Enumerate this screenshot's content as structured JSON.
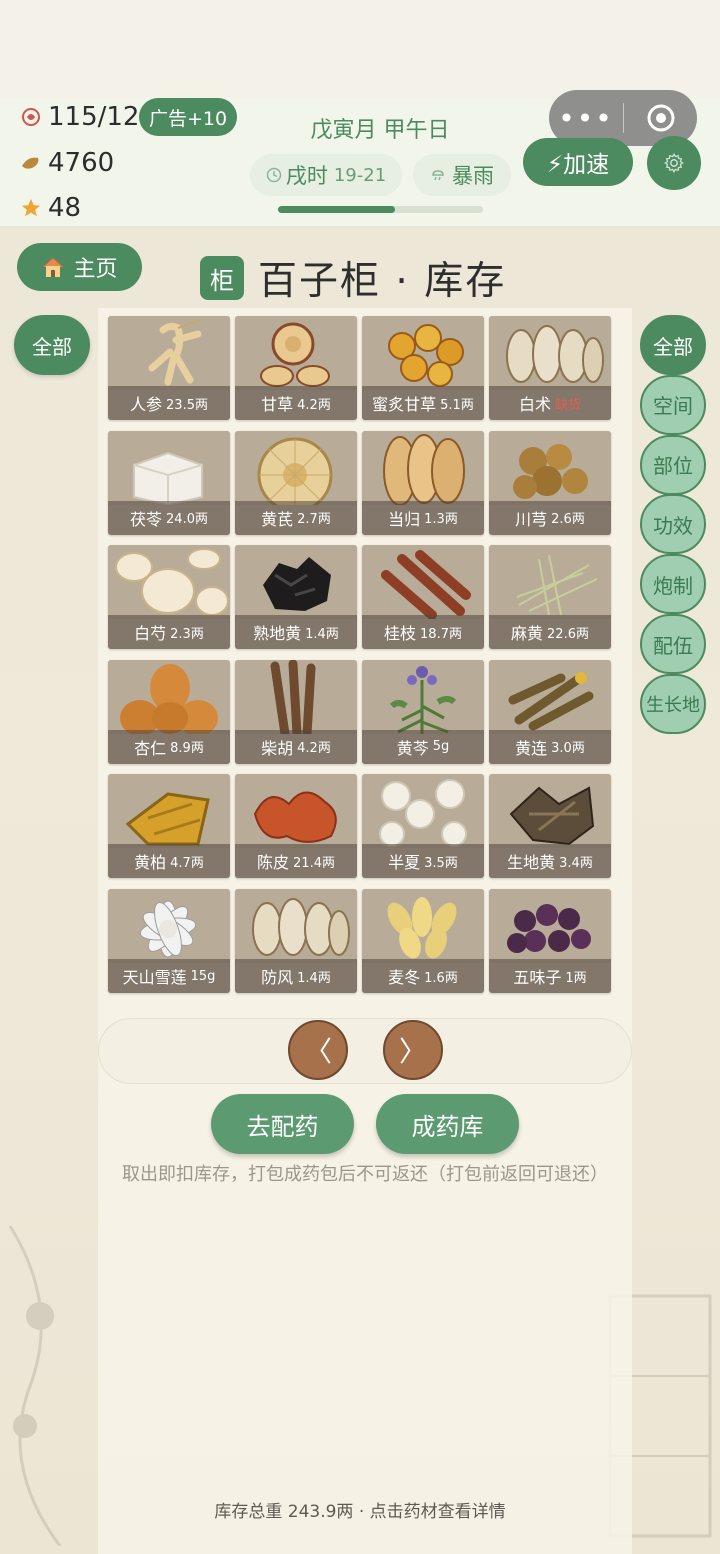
{
  "status": {
    "energy": "115/120",
    "ad_label": "广告+10",
    "coins": "4760",
    "stars": "48",
    "date": "戊寅月 甲午日",
    "time_label": "戌时",
    "time_range": "19-21",
    "weather": "暴雨",
    "day_progress": 0.57,
    "speed_label": "⚡加速"
  },
  "capsule": {
    "more": "•••"
  },
  "nav": {
    "home_label": "主页"
  },
  "title": {
    "badge": "柜",
    "text": "百子柜 · 库存"
  },
  "left_filter": {
    "label": "全部"
  },
  "right_tabs": [
    "全部",
    "空间",
    "部位",
    "功效",
    "炮制",
    "配伍",
    "生长地"
  ],
  "herbs": [
    {
      "name": "人参",
      "qty": "23.5两",
      "art": "ginseng"
    },
    {
      "name": "甘草",
      "qty": "4.2两",
      "art": "slices"
    },
    {
      "name": "蜜炙甘草",
      "qty": "5.1两",
      "art": "honeyslices"
    },
    {
      "name": "白术",
      "qty": "",
      "lack": "缺货",
      "art": "baizhu"
    },
    {
      "name": "茯苓",
      "qty": "24.0两",
      "art": "cube"
    },
    {
      "name": "黄芪",
      "qty": "2.7两",
      "art": "bigslice"
    },
    {
      "name": "当归",
      "qty": "1.3两",
      "art": "danggui"
    },
    {
      "name": "川芎",
      "qty": "2.6两",
      "art": "chuanxiong"
    },
    {
      "name": "白芍",
      "qty": "2.3两",
      "art": "whiteslices"
    },
    {
      "name": "熟地黄",
      "qty": "1.4两",
      "art": "black"
    },
    {
      "name": "桂枝",
      "qty": "18.7两",
      "art": "sticks"
    },
    {
      "name": "麻黄",
      "qty": "22.6两",
      "art": "grass"
    },
    {
      "name": "杏仁",
      "qty": "8.9两",
      "art": "almond"
    },
    {
      "name": "柴胡",
      "qty": "4.2两",
      "art": "roots"
    },
    {
      "name": "黄芩",
      "qty": "5g",
      "art": "flower"
    },
    {
      "name": "黄连",
      "qty": "3.0两",
      "art": "huanglian"
    },
    {
      "name": "黄柏",
      "qty": "4.7两",
      "art": "bark"
    },
    {
      "name": "陈皮",
      "qty": "21.4两",
      "art": "peel"
    },
    {
      "name": "半夏",
      "qty": "3.5两",
      "art": "banxia"
    },
    {
      "name": "生地黄",
      "qty": "3.4两",
      "art": "dihuang"
    },
    {
      "name": "天山雪莲",
      "qty": "15g",
      "art": "lotus"
    },
    {
      "name": "防风",
      "qty": "1.4两",
      "art": "baizhu"
    },
    {
      "name": "麦冬",
      "qty": "1.6两",
      "art": "maidong"
    },
    {
      "name": "五味子",
      "qty": "1两",
      "art": "berries"
    }
  ],
  "pager": {
    "prev": "〈",
    "next": "〉"
  },
  "actions": {
    "dispense": "去配药",
    "finished": "成药库"
  },
  "hint": "取出即扣库存，打包成药包后不可返还（打包前返回可退还）",
  "footer": "库存总重 243.9两 · 点击药材查看详情",
  "colors": {
    "primary": "#4c8a5f",
    "tab_inactive": "#9fcfb0",
    "pager": "#a6714b",
    "lack": "#e65c4f"
  }
}
